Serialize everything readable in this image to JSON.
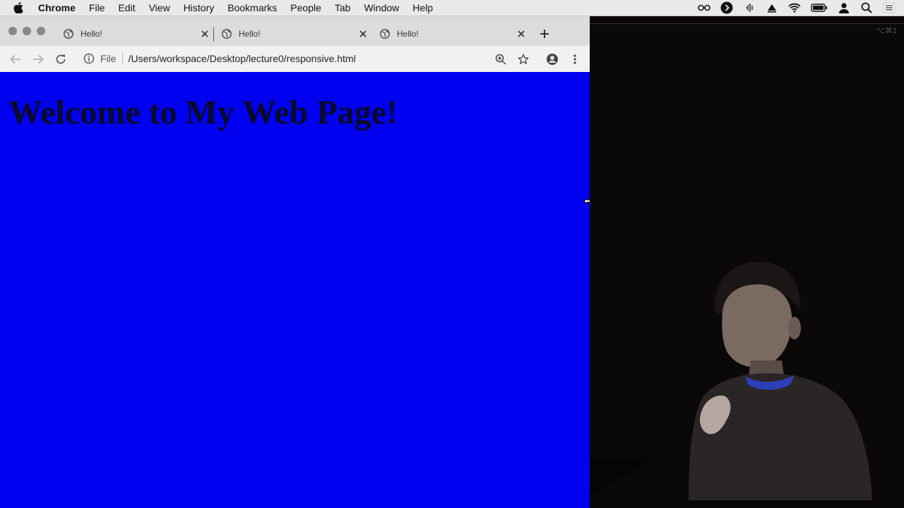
{
  "menubar": {
    "items": [
      "Chrome",
      "File",
      "Edit",
      "View",
      "History",
      "Bookmarks",
      "People",
      "Tab",
      "Window",
      "Help"
    ],
    "status_icons": [
      "glasses-icon",
      "play-circle-icon",
      "audio-icon",
      "airplay-icon",
      "wifi-icon",
      "battery-icon",
      "user-icon",
      "search-icon",
      "list-icon"
    ]
  },
  "tabs": [
    {
      "title": "Hello!"
    },
    {
      "title": "Hello!"
    },
    {
      "title": "Hello!"
    }
  ],
  "toolbar": {
    "scheme": "File",
    "url": "/Users/workspace/Desktop/lecture0/responsive.html"
  },
  "page": {
    "heading": "Welcome to My Web Page!",
    "background_color": "#0000f0"
  },
  "video": {
    "shortcut_hint": "⌥⌘1"
  }
}
